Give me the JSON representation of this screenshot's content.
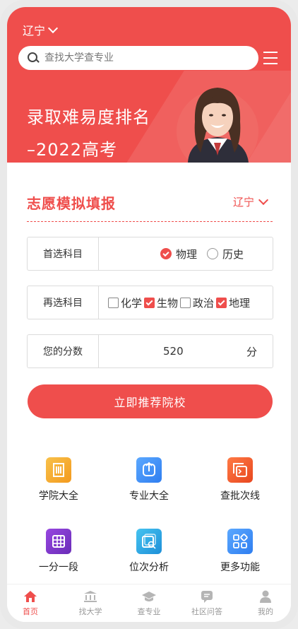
{
  "header": {
    "region": "辽宁",
    "search_placeholder": "查找大学查专业"
  },
  "banner": {
    "line1": "录取难易度排名",
    "line2": "–2022高考"
  },
  "form": {
    "title": "志愿模拟填报",
    "region": "辽宁",
    "first_subject": {
      "label": "首选科目",
      "options": [
        {
          "name": "物理",
          "checked": true
        },
        {
          "name": "历史",
          "checked": false
        }
      ]
    },
    "second_subject": {
      "label": "再选科目",
      "options": [
        {
          "name": "化学",
          "checked": false
        },
        {
          "name": "生物",
          "checked": true
        },
        {
          "name": "政治",
          "checked": false
        },
        {
          "name": "地理",
          "checked": true
        }
      ]
    },
    "score": {
      "label": "您的分数",
      "value": "520",
      "unit": "分"
    },
    "submit_label": "立即推荐院校"
  },
  "features": [
    {
      "label": "学院大全",
      "icon": "building-icon",
      "color": "#f5a623"
    },
    {
      "label": "专业大全",
      "icon": "upload-icon",
      "color": "#3e8ef7"
    },
    {
      "label": "查批次线",
      "icon": "terminal-icon",
      "color": "#f0582e"
    },
    {
      "label": "一分一段",
      "icon": "table-icon",
      "color": "#7b3fc6"
    },
    {
      "label": "位次分析",
      "icon": "rank-search-icon",
      "color": "#2ba3e8"
    },
    {
      "label": "更多功能",
      "icon": "apps-icon",
      "color": "#3e8ef7"
    }
  ],
  "tabs": [
    {
      "label": "首页",
      "icon": "home-icon",
      "active": true
    },
    {
      "label": "找大学",
      "icon": "university-icon",
      "active": false
    },
    {
      "label": "查专业",
      "icon": "graduation-cap-icon",
      "active": false
    },
    {
      "label": "社区问答",
      "icon": "chat-icon",
      "active": false
    },
    {
      "label": "我的",
      "icon": "user-icon",
      "active": false
    }
  ],
  "colors": {
    "accent": "#ef4e4c",
    "inactive_tab": "#999999"
  }
}
